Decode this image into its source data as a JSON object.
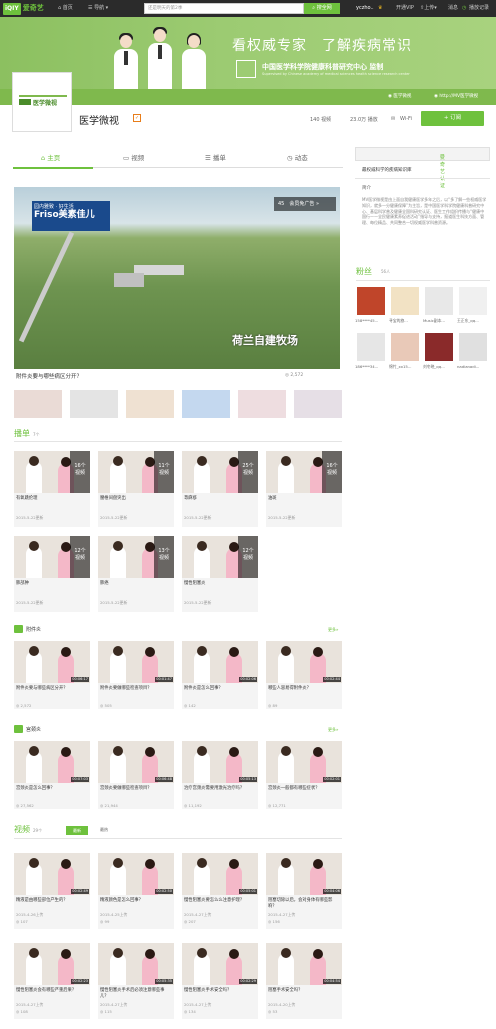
{
  "topbar": {
    "logo_badge": "iQIY",
    "logo_text": "爱奇艺",
    "home": "首页",
    "nav": "导航",
    "search_placeholder": "还是明天的第2季",
    "search_button": "搜全网",
    "user": "yczho..",
    "vip": "开通VIP",
    "upload": "上传",
    "message": "消息",
    "history": "播放记录"
  },
  "banner": {
    "slogan": "看权威专家　了解疾病常识",
    "org": "中国医学科学院健康科普研究中心 监制",
    "org_en": "Supervised by Chinese academy of medical sciences health science research center",
    "link1": "医学微视",
    "link2": "http://MV医学微视"
  },
  "channel": {
    "avatar_text": "医学微视",
    "name": "医学微视",
    "badge": "✓",
    "videos": "140 视频",
    "plays": "23.0万 播放",
    "wifi": "Wi-Fi",
    "subscribe": "+ 订阅"
  },
  "tabs": [
    {
      "label": "主页"
    },
    {
      "label": "视频"
    },
    {
      "label": "播单"
    },
    {
      "label": "动态"
    }
  ],
  "player": {
    "ad_line1": "园内雅致 · 好生活",
    "ad_brand": "Friso美素佳儿",
    "ad_tag": "会员免广告 »",
    "ad_countdown": "45",
    "farm_name": "荷兰自建牧场",
    "title": "附件炎要与哪些病区分开？",
    "count": "2,572"
  },
  "playlists": {
    "heading": "播单",
    "count": "7个",
    "items": [
      {
        "title": "有氧跳伦理",
        "n": "16个",
        "unit": "视频",
        "date": "2015-5-22更新"
      },
      {
        "title": "腰椎间盘突出",
        "n": "11个",
        "unit": "视频",
        "date": "2015-5-22更新"
      },
      {
        "title": "荨麻疹",
        "n": "25个",
        "unit": "视频",
        "date": "2015-5-22更新"
      },
      {
        "title": "油斑",
        "n": "16个",
        "unit": "视频",
        "date": "2015-5-22更新"
      },
      {
        "title": "肺部肿",
        "n": "12个",
        "unit": "视频",
        "date": "2015-5-22更新"
      },
      {
        "title": "肺癌",
        "n": "13个",
        "unit": "视频",
        "date": "2015-5-22更新"
      },
      {
        "title": "慢性阻塞炎",
        "n": "12个",
        "unit": "视频",
        "date": "2015-5-22更新"
      }
    ]
  },
  "sections": [
    {
      "title": "附件炎",
      "more": "更多»",
      "items": [
        {
          "title": "附件炎要与哪些病区分开？",
          "dur": "00:06:17",
          "views": "2,572"
        },
        {
          "title": "附件炎要做哪些检查项目？",
          "dur": "00:01:47",
          "views": "505"
        },
        {
          "title": "附件炎是怎么回事？",
          "dur": "00:02:06",
          "views": "142"
        },
        {
          "title": "哪些人容易得附件炎？",
          "dur": "00:02:44",
          "views": "89"
        }
      ]
    },
    {
      "title": "宫颈炎",
      "more": "更多»",
      "items": [
        {
          "title": "宫颈炎是怎么回事？",
          "dur": "00:07:03",
          "views": "27,562"
        },
        {
          "title": "宫颈炎要做哪些检查项目？",
          "dur": "00:06:48",
          "views": "21,944"
        },
        {
          "title": "治疗宫颈炎需要用激光治疗吗？",
          "dur": "00:05:13",
          "views": "11,192"
        },
        {
          "title": "宫颈炎一般都有哪些症状？",
          "dur": "00:02:01",
          "views": "12,771"
        }
      ]
    }
  ],
  "videos": {
    "heading": "视频",
    "count": "29个",
    "filter_active": "最新",
    "filter_other": "最热",
    "items": [
      {
        "title": "精液是由哪些部位产生的？",
        "dur": "00:02:49",
        "date": "2015-4-26上传",
        "views": "107"
      },
      {
        "title": "精液颜色是怎么回事？",
        "dur": "00:02:50",
        "date": "2015-4-25上传",
        "views": "99"
      },
      {
        "title": "慢性阻塞炎要怎么么注意护理？",
        "dur": "00:05:01",
        "date": "2015-4-27上传",
        "views": "207"
      },
      {
        "title": "阻塞切除以后，会对身体有哪些影响？",
        "dur": "00:04:06",
        "date": "2015-4-27上传",
        "views": "156"
      },
      {
        "title": "慢性阻塞炎会有哪些严重后果？",
        "dur": "00:02:23",
        "date": "2015-4-27上传",
        "views": "108"
      },
      {
        "title": "慢性阻塞炎手术后必须注意哪些事儿？",
        "dur": "00:05:35",
        "date": "2015-4-27上传",
        "views": "115"
      },
      {
        "title": "慢性阻塞炎手术安全吗？",
        "dur": "00:02:29",
        "date": "2015-4-27上传",
        "views": "134"
      },
      {
        "title": "阻塞手术安全吗？",
        "dur": "00:04:54",
        "date": "2015-4-20上传",
        "views": "53"
      }
    ]
  },
  "sidebar": {
    "cert_title": "爱奇艺认证",
    "cert_text": "最权威科学的疾病知识库",
    "intro_title": "简介",
    "intro_text": "MV医学微视是由上面自我健康医学多年之后，以“多了解一些权威医学知识，就多一分健康保障”为主旨，是中国医学科学院健康科普研究中心、基层科学普及健康全国科研究认证、医生工作组织传播与“健康中国行——全民健康素养促进活动”指导与支持，报道医生科技方面、管理、每位精品、共同整合一切权威医学科普资源。",
    "fans_title": "粉丝",
    "fans_count": "56人",
    "fans": [
      {
        "name": "158****45..."
      },
      {
        "name": "寻宝的旅..."
      },
      {
        "name": "Music副本..."
      },
      {
        "name": "王正东_qq..."
      },
      {
        "name": "186****34..."
      },
      {
        "name": "绵竹_xx15..."
      },
      {
        "name": "刘冬晓_qq..."
      },
      {
        "name": "nadianadi..."
      }
    ]
  }
}
